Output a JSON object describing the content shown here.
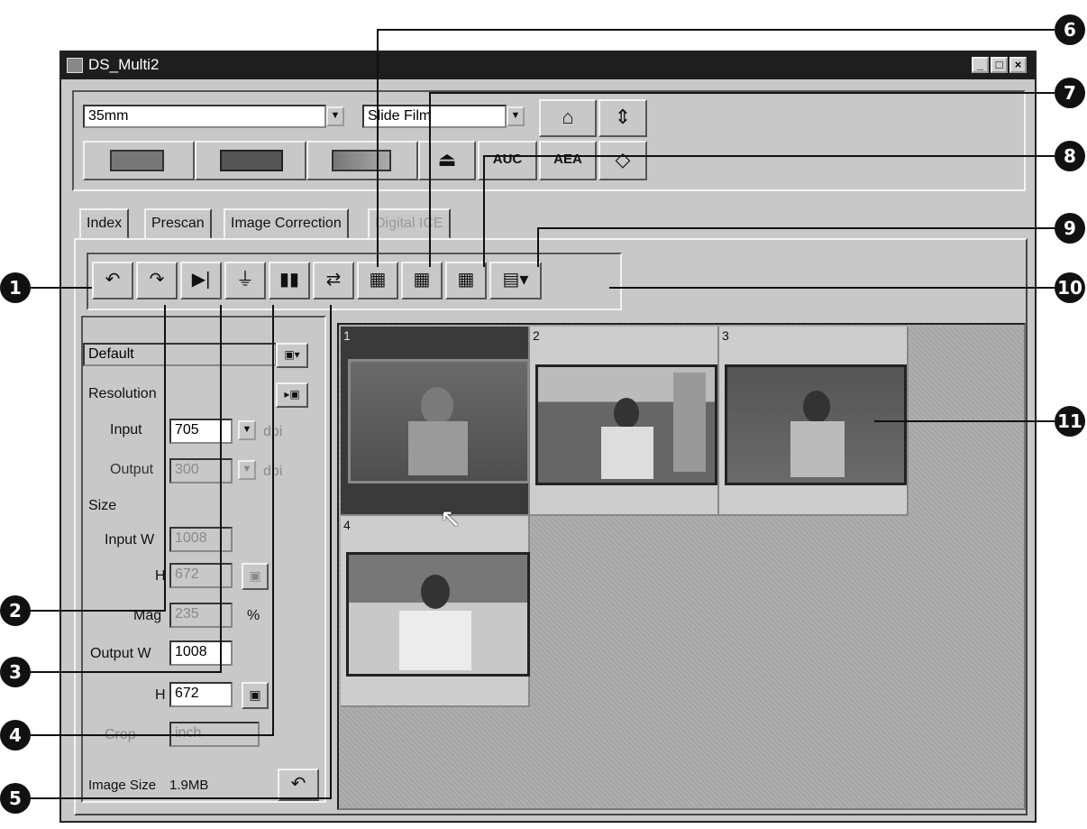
{
  "window": {
    "title": "DS_Multi2",
    "min": "_",
    "max": "□",
    "close": "×"
  },
  "toolbar": {
    "film_format": "35mm",
    "film_type": "Slide Film",
    "icons": [
      "preview-film-icon",
      "index-film-icon",
      "scan-icon",
      "eject-icon",
      "auto-exposure-icon",
      "ae-lock-icon",
      "rotate-icon",
      "help-icon",
      "fit-icon"
    ],
    "row2_labels": [
      "AUC",
      "AEA"
    ]
  },
  "tabs": [
    "Index",
    "Prescan",
    "Image Correction",
    "Digital ICE"
  ],
  "tool_buttons": [
    "rotate-left",
    "rotate-right",
    "flip-horizontal",
    "flip-vertical",
    "mirror",
    "swap",
    "select-all",
    "select-1",
    "select-2",
    "view-options"
  ],
  "settings": {
    "preset": "Default",
    "resolution_label": "Resolution",
    "input_label": "Input",
    "input_value": "705",
    "input_unit": "dpi",
    "output_label": "Output",
    "output_value": "300",
    "output_unit": "dpi",
    "size_label": "Size",
    "input_w_label": "Input W",
    "input_w_value": "1008",
    "h_label": "H",
    "input_h_value": "672",
    "mag_label": "Mag",
    "mag_value": "235",
    "mag_unit": "%",
    "output_w_label": "Output W",
    "output_w_value": "1008",
    "output_h_value": "672",
    "crop_label": "Crop",
    "crop_value": "inch",
    "image_size_label": "Image Size",
    "image_size_value": "1.9MB"
  },
  "thumbnails": [
    {
      "number": "1",
      "selected": true
    },
    {
      "number": "2",
      "selected": false
    },
    {
      "number": "3",
      "selected": false
    },
    {
      "number": "4",
      "selected": false
    }
  ],
  "callouts": [
    "1",
    "2",
    "3",
    "4",
    "5",
    "6",
    "7",
    "8",
    "9",
    "10",
    "11"
  ]
}
